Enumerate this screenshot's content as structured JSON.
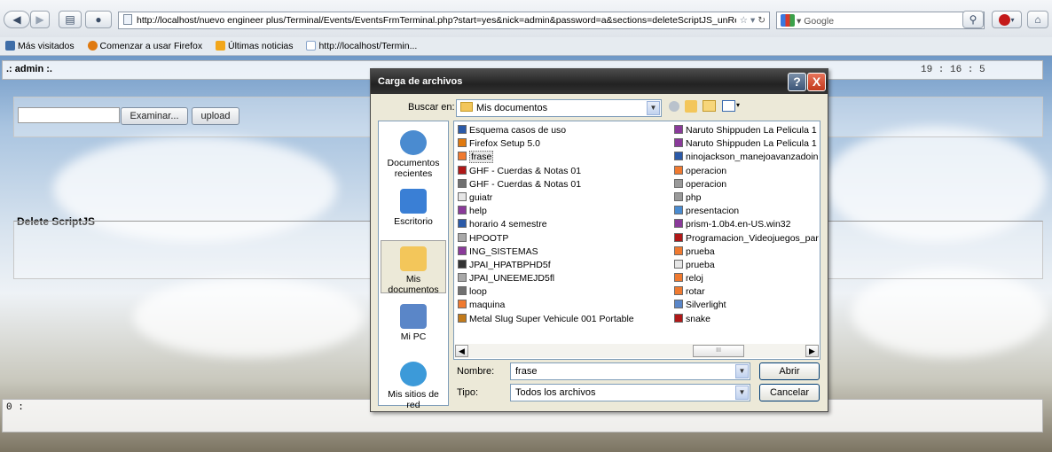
{
  "browser": {
    "url": "http://localhost/nuevo engineer plus/Terminal/Events/EventsFrmTerminal.php?start=yes&nick=admin&password=a&sections=deleteScriptJS_unRegiste",
    "search_engine": "Google",
    "bookmarks": [
      {
        "label": "Más visitados",
        "color": "#3f6ea8"
      },
      {
        "label": "Comenzar a usar Firefox",
        "color": "#e07a10"
      },
      {
        "label": "Últimas noticias",
        "color": "#f2a71b"
      },
      {
        "label": "http://localhost/Termin...",
        "color": "#8aa6cc"
      }
    ]
  },
  "page": {
    "user_label": ".: admin :.",
    "clock": "19 : 16 : 5",
    "browse_button": "Examinar...",
    "upload_button": "upload",
    "section_title": "Delete ScriptJS",
    "bottom_label": "0 :"
  },
  "dialog": {
    "title": "Carga de archivos",
    "help_button": "?",
    "close_button": "X",
    "look_in_label": "Buscar en:",
    "look_in_value": "Mis documentos",
    "places": [
      {
        "label": "Documentos recientes",
        "color": "#4a8bd0"
      },
      {
        "label": "Escritorio",
        "color": "#3a7fd5"
      },
      {
        "label": "Mis documentos",
        "color": "#f3c65a"
      },
      {
        "label": "Mi PC",
        "color": "#5a86c8"
      },
      {
        "label": "Mis sitios de red",
        "color": "#3c9ad9"
      }
    ],
    "files_left": [
      {
        "name": "Esquema casos de uso",
        "icon": "word-doc-icon",
        "color": "#2b5aa8"
      },
      {
        "name": "Firefox Setup 5.0",
        "icon": "installer-icon",
        "color": "#e07a10"
      },
      {
        "name": "frase",
        "icon": "image-icon",
        "color": "#f07a30",
        "selected": true
      },
      {
        "name": "GHF - Cuerdas & Notas 01",
        "icon": "pdf-icon",
        "color": "#b01818"
      },
      {
        "name": "GHF - Cuerdas & Notas 01",
        "icon": "document-icon",
        "color": "#707070"
      },
      {
        "name": "guiatr",
        "icon": "file-icon",
        "color": "#e6e6e6"
      },
      {
        "name": "help",
        "icon": "archive-icon",
        "color": "#8a3a9a"
      },
      {
        "name": "horario 4 semestre",
        "icon": "word-doc-icon",
        "color": "#2b5aa8"
      },
      {
        "name": "HPOOTP",
        "icon": "disc-icon",
        "color": "#a8a8a8"
      },
      {
        "name": "ING_SISTEMAS",
        "icon": "archive-icon",
        "color": "#8a3a9a"
      },
      {
        "name": "JPAI_HPATBPHD5f",
        "icon": "video-icon",
        "color": "#333333"
      },
      {
        "name": "JPAI_UNEEMEJD5fl",
        "icon": "disc-icon",
        "color": "#a8a8a8"
      },
      {
        "name": "loop",
        "icon": "document-icon",
        "color": "#707070"
      },
      {
        "name": "maquina",
        "icon": "image-icon",
        "color": "#f07a30"
      },
      {
        "name": "Metal Slug Super Vehicule 001 Portable",
        "icon": "game-icon",
        "color": "#c27a1a"
      }
    ],
    "files_right": [
      {
        "name": "Naruto Shippuden La Pelicula 1",
        "icon": "archive-icon",
        "color": "#8a3a9a"
      },
      {
        "name": "Naruto Shippuden La Pelicula 1",
        "icon": "archive-icon",
        "color": "#8a3a9a"
      },
      {
        "name": "ninojackson_manejoavanzadoin",
        "icon": "word-doc-icon",
        "color": "#2b5aa8"
      },
      {
        "name": "operacion",
        "icon": "image-icon",
        "color": "#f07a30"
      },
      {
        "name": "operacion",
        "icon": "text-icon",
        "color": "#9a9a9a"
      },
      {
        "name": "php",
        "icon": "text-icon",
        "color": "#9a9a9a"
      },
      {
        "name": "presentacion",
        "icon": "image-icon",
        "color": "#4a8bd0"
      },
      {
        "name": "prism-1.0b4.en-US.win32",
        "icon": "archive-icon",
        "color": "#8a3a9a"
      },
      {
        "name": "Programacion_Videojuegos_par",
        "icon": "pdf-icon",
        "color": "#b01818"
      },
      {
        "name": "prueba",
        "icon": "image-icon",
        "color": "#f07a30"
      },
      {
        "name": "prueba",
        "icon": "file-icon",
        "color": "#e6e6e6"
      },
      {
        "name": "reloj",
        "icon": "image-icon",
        "color": "#f07a30"
      },
      {
        "name": "rotar",
        "icon": "image-icon",
        "color": "#f07a30"
      },
      {
        "name": "Silverlight",
        "icon": "window-icon",
        "color": "#5a86c8"
      },
      {
        "name": "snake",
        "icon": "pdf-icon",
        "color": "#b01818"
      }
    ],
    "scroll_mark": "III",
    "filename_label": "Nombre:",
    "filename_value": "frase",
    "filetype_label": "Tipo:",
    "filetype_value": "Todos los archivos",
    "open_button": "Abrir",
    "cancel_button": "Cancelar"
  }
}
